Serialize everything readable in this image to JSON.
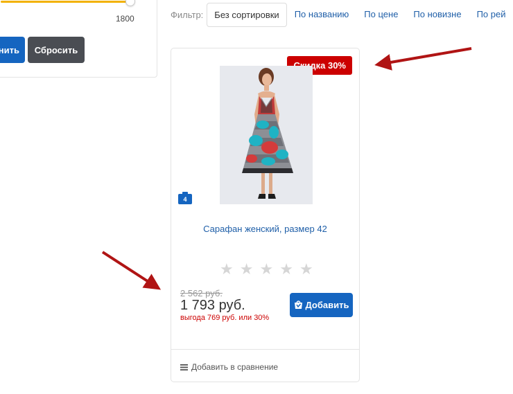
{
  "filter_panel": {
    "slider_value": "1800",
    "apply_label": "менить",
    "reset_label": "Сбросить"
  },
  "sortbar": {
    "label": "Фильтр:",
    "items": [
      {
        "label": "Без сортировки"
      },
      {
        "label": "По названию"
      },
      {
        "label": "По цене"
      },
      {
        "label": "По новизне"
      },
      {
        "label": "По рей"
      }
    ]
  },
  "product": {
    "badge": "Скидка 30%",
    "photo_count": "4",
    "title": "Сарафан женский, размер 42",
    "rating": 0,
    "rating_max": 5,
    "old_price": "2 562 руб.",
    "new_price": "1 793 руб.",
    "savings": "выгода 769 руб. или 30%",
    "add_label": "Добавить",
    "compare_label": "Добавить в сравнение"
  },
  "colors": {
    "primary": "#1565c0",
    "badge": "#cc0000",
    "arrow": "#b01414",
    "slider": "#f2b100"
  }
}
